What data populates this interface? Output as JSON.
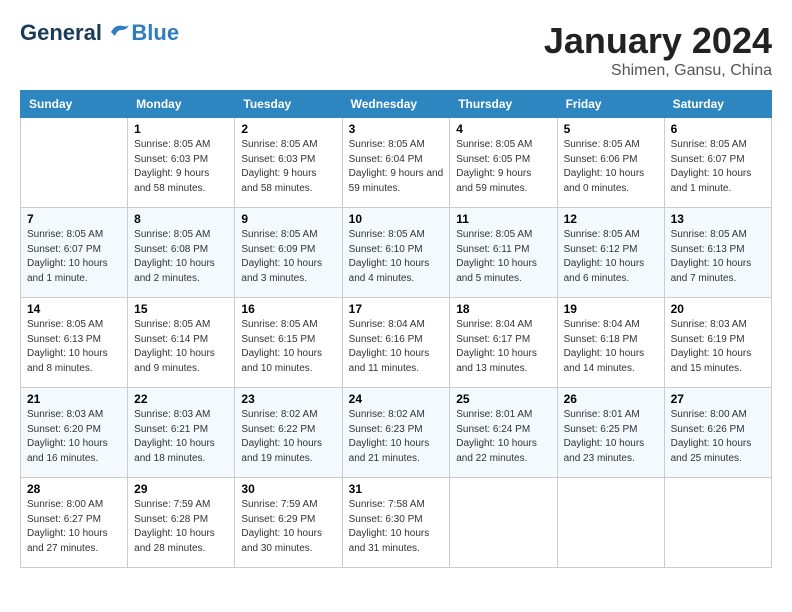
{
  "header": {
    "logo_general": "General",
    "logo_blue": "Blue",
    "month_year": "January 2024",
    "location": "Shimen, Gansu, China"
  },
  "days_of_week": [
    "Sunday",
    "Monday",
    "Tuesday",
    "Wednesday",
    "Thursday",
    "Friday",
    "Saturday"
  ],
  "weeks": [
    [
      {
        "day": "",
        "sunrise": "",
        "sunset": "",
        "daylight": ""
      },
      {
        "day": "1",
        "sunrise": "Sunrise: 8:05 AM",
        "sunset": "Sunset: 6:03 PM",
        "daylight": "Daylight: 9 hours and 58 minutes."
      },
      {
        "day": "2",
        "sunrise": "Sunrise: 8:05 AM",
        "sunset": "Sunset: 6:03 PM",
        "daylight": "Daylight: 9 hours and 58 minutes."
      },
      {
        "day": "3",
        "sunrise": "Sunrise: 8:05 AM",
        "sunset": "Sunset: 6:04 PM",
        "daylight": "Daylight: 9 hours and 59 minutes."
      },
      {
        "day": "4",
        "sunrise": "Sunrise: 8:05 AM",
        "sunset": "Sunset: 6:05 PM",
        "daylight": "Daylight: 9 hours and 59 minutes."
      },
      {
        "day": "5",
        "sunrise": "Sunrise: 8:05 AM",
        "sunset": "Sunset: 6:06 PM",
        "daylight": "Daylight: 10 hours and 0 minutes."
      },
      {
        "day": "6",
        "sunrise": "Sunrise: 8:05 AM",
        "sunset": "Sunset: 6:07 PM",
        "daylight": "Daylight: 10 hours and 1 minute."
      }
    ],
    [
      {
        "day": "7",
        "sunrise": "Sunrise: 8:05 AM",
        "sunset": "Sunset: 6:07 PM",
        "daylight": "Daylight: 10 hours and 1 minute."
      },
      {
        "day": "8",
        "sunrise": "Sunrise: 8:05 AM",
        "sunset": "Sunset: 6:08 PM",
        "daylight": "Daylight: 10 hours and 2 minutes."
      },
      {
        "day": "9",
        "sunrise": "Sunrise: 8:05 AM",
        "sunset": "Sunset: 6:09 PM",
        "daylight": "Daylight: 10 hours and 3 minutes."
      },
      {
        "day": "10",
        "sunrise": "Sunrise: 8:05 AM",
        "sunset": "Sunset: 6:10 PM",
        "daylight": "Daylight: 10 hours and 4 minutes."
      },
      {
        "day": "11",
        "sunrise": "Sunrise: 8:05 AM",
        "sunset": "Sunset: 6:11 PM",
        "daylight": "Daylight: 10 hours and 5 minutes."
      },
      {
        "day": "12",
        "sunrise": "Sunrise: 8:05 AM",
        "sunset": "Sunset: 6:12 PM",
        "daylight": "Daylight: 10 hours and 6 minutes."
      },
      {
        "day": "13",
        "sunrise": "Sunrise: 8:05 AM",
        "sunset": "Sunset: 6:13 PM",
        "daylight": "Daylight: 10 hours and 7 minutes."
      }
    ],
    [
      {
        "day": "14",
        "sunrise": "Sunrise: 8:05 AM",
        "sunset": "Sunset: 6:13 PM",
        "daylight": "Daylight: 10 hours and 8 minutes."
      },
      {
        "day": "15",
        "sunrise": "Sunrise: 8:05 AM",
        "sunset": "Sunset: 6:14 PM",
        "daylight": "Daylight: 10 hours and 9 minutes."
      },
      {
        "day": "16",
        "sunrise": "Sunrise: 8:05 AM",
        "sunset": "Sunset: 6:15 PM",
        "daylight": "Daylight: 10 hours and 10 minutes."
      },
      {
        "day": "17",
        "sunrise": "Sunrise: 8:04 AM",
        "sunset": "Sunset: 6:16 PM",
        "daylight": "Daylight: 10 hours and 11 minutes."
      },
      {
        "day": "18",
        "sunrise": "Sunrise: 8:04 AM",
        "sunset": "Sunset: 6:17 PM",
        "daylight": "Daylight: 10 hours and 13 minutes."
      },
      {
        "day": "19",
        "sunrise": "Sunrise: 8:04 AM",
        "sunset": "Sunset: 6:18 PM",
        "daylight": "Daylight: 10 hours and 14 minutes."
      },
      {
        "day": "20",
        "sunrise": "Sunrise: 8:03 AM",
        "sunset": "Sunset: 6:19 PM",
        "daylight": "Daylight: 10 hours and 15 minutes."
      }
    ],
    [
      {
        "day": "21",
        "sunrise": "Sunrise: 8:03 AM",
        "sunset": "Sunset: 6:20 PM",
        "daylight": "Daylight: 10 hours and 16 minutes."
      },
      {
        "day": "22",
        "sunrise": "Sunrise: 8:03 AM",
        "sunset": "Sunset: 6:21 PM",
        "daylight": "Daylight: 10 hours and 18 minutes."
      },
      {
        "day": "23",
        "sunrise": "Sunrise: 8:02 AM",
        "sunset": "Sunset: 6:22 PM",
        "daylight": "Daylight: 10 hours and 19 minutes."
      },
      {
        "day": "24",
        "sunrise": "Sunrise: 8:02 AM",
        "sunset": "Sunset: 6:23 PM",
        "daylight": "Daylight: 10 hours and 21 minutes."
      },
      {
        "day": "25",
        "sunrise": "Sunrise: 8:01 AM",
        "sunset": "Sunset: 6:24 PM",
        "daylight": "Daylight: 10 hours and 22 minutes."
      },
      {
        "day": "26",
        "sunrise": "Sunrise: 8:01 AM",
        "sunset": "Sunset: 6:25 PM",
        "daylight": "Daylight: 10 hours and 23 minutes."
      },
      {
        "day": "27",
        "sunrise": "Sunrise: 8:00 AM",
        "sunset": "Sunset: 6:26 PM",
        "daylight": "Daylight: 10 hours and 25 minutes."
      }
    ],
    [
      {
        "day": "28",
        "sunrise": "Sunrise: 8:00 AM",
        "sunset": "Sunset: 6:27 PM",
        "daylight": "Daylight: 10 hours and 27 minutes."
      },
      {
        "day": "29",
        "sunrise": "Sunrise: 7:59 AM",
        "sunset": "Sunset: 6:28 PM",
        "daylight": "Daylight: 10 hours and 28 minutes."
      },
      {
        "day": "30",
        "sunrise": "Sunrise: 7:59 AM",
        "sunset": "Sunset: 6:29 PM",
        "daylight": "Daylight: 10 hours and 30 minutes."
      },
      {
        "day": "31",
        "sunrise": "Sunrise: 7:58 AM",
        "sunset": "Sunset: 6:30 PM",
        "daylight": "Daylight: 10 hours and 31 minutes."
      },
      {
        "day": "",
        "sunrise": "",
        "sunset": "",
        "daylight": ""
      },
      {
        "day": "",
        "sunrise": "",
        "sunset": "",
        "daylight": ""
      },
      {
        "day": "",
        "sunrise": "",
        "sunset": "",
        "daylight": ""
      }
    ]
  ]
}
